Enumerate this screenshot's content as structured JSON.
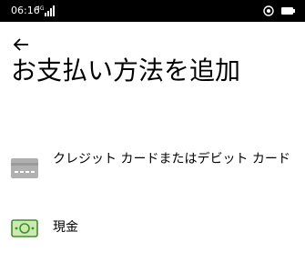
{
  "status_bar": {
    "time": "06:16",
    "network_label": "4G",
    "icons": [
      "signal-icon",
      "alarm-icon",
      "battery-icon"
    ]
  },
  "header": {
    "back_icon": "back-arrow-icon",
    "title": "お支払い方法を追加"
  },
  "payment_options": [
    {
      "label": "クレジット カードまたはデビット カード",
      "icon": "credit-card-icon"
    },
    {
      "label": "現金",
      "icon": "cash-icon"
    }
  ],
  "colors": {
    "status_bar_bg": "#000000",
    "card_icon": "#b0b0b0",
    "cash_icon_fill": "#cde9b2",
    "cash_icon_stroke": "#3f8f2f"
  }
}
